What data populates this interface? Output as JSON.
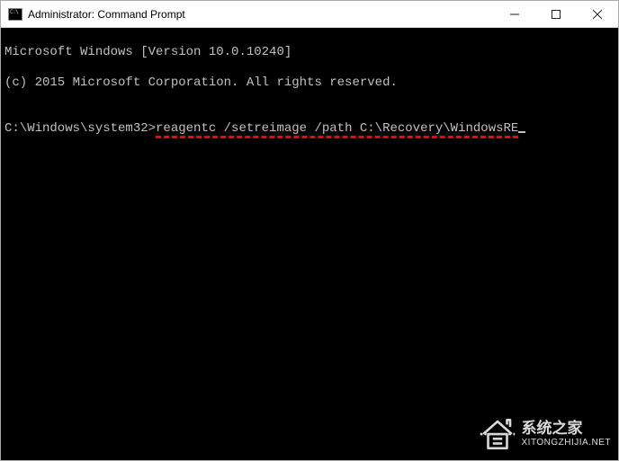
{
  "window": {
    "title": "Administrator: Command Prompt"
  },
  "terminal": {
    "line1": "Microsoft Windows [Version 10.0.10240]",
    "line2": "(c) 2015 Microsoft Corporation. All rights reserved.",
    "blank": "",
    "prompt": "C:\\Windows\\system32>",
    "command": "reagentc /setreimage /path C:\\Recovery\\WindowsRE"
  },
  "watermark": {
    "name": "系统之家",
    "url": "XITONGZHIJIA.NET"
  },
  "icons": {
    "app": "cmd-icon",
    "minimize": "minimize-icon",
    "maximize": "maximize-icon",
    "close": "close-icon",
    "house": "house-icon"
  }
}
